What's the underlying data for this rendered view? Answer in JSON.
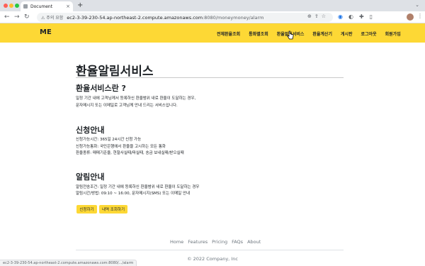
{
  "browser": {
    "tab_title": "Document",
    "tab_close_icon": "×",
    "new_tab_icon": "+",
    "site_info": "주의 요함",
    "url_host": "ec2-3-39-230-54.ap-northeast-2.compute.amazonaws.com",
    "url_path": ":8080/moneymoney/alarm",
    "status_url": "ec2-3-39-230-54.ap-northeast-2.compute.amazonaws.com:8080/.../alarm"
  },
  "navbar": {
    "brand": "ME",
    "links": [
      "전체환율조회",
      "통화별조회",
      "환율알림서비스",
      "환율계산기",
      "게시판",
      "로그아웃",
      "회원가입"
    ]
  },
  "page": {
    "title": "환율알림서비스",
    "sections": [
      {
        "title": "환율서비스란 ?",
        "lines": [
          "일정 기간 내에 고객님께서 등록하신 환율범위 내로 환율이 도달하는 경우,",
          "문자메시지 또는 이메일로 고객님께 안내 드리는 서비스입니다."
        ]
      },
      {
        "title": "신청안내",
        "lines": [
          "신청가능시간: 365일 24시간 신청 가능",
          "신청가능통화: 국민은행에서 환율을 고시하는 모든 통화",
          "환율종류: 매매기준율, 현찰사실때/파실때, 송금 보내실때/받으실때"
        ]
      },
      {
        "title": "알림안내",
        "lines": [
          "알림전송조건: 일정 기간 내에 등록하신 환율범위 내로 환율이 도달하는 경우",
          "알림시간/방법: 09:10 ~ 16:00, 문자메시지(SMS) 또는 이메일 안내"
        ]
      }
    ],
    "buttons": {
      "apply": "신청하기",
      "history": "내역 조회하기"
    }
  },
  "footer": {
    "links": [
      "Home",
      "Features",
      "Pricing",
      "FAQs",
      "About"
    ],
    "copyright": "© 2022 Company, Inc"
  },
  "colors": {
    "accent": "#fdd835",
    "text": "#212529",
    "muted": "#6c757d"
  }
}
